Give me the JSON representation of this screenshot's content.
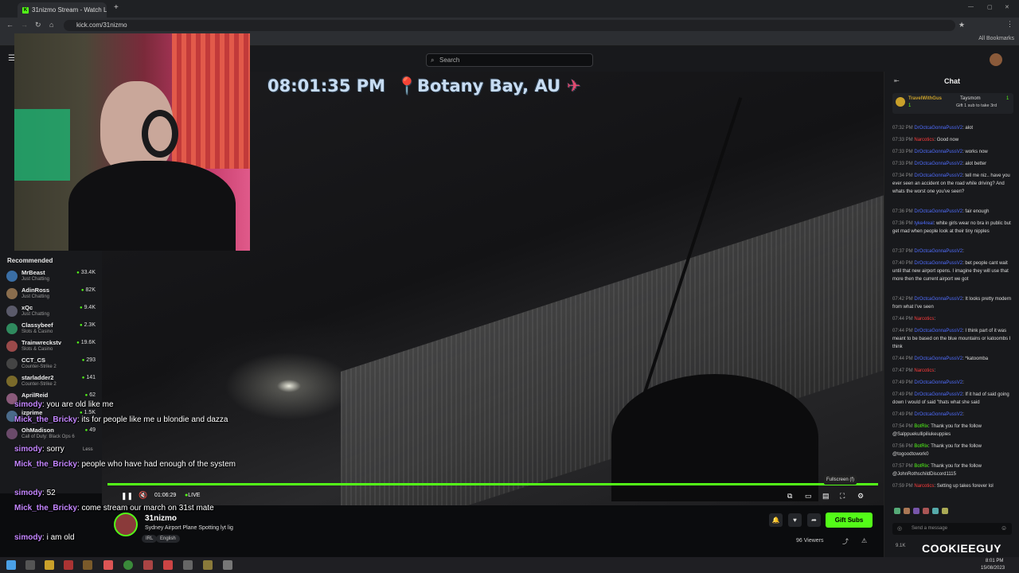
{
  "browser": {
    "tab_title": "31nizmo Stream - Watch Live o",
    "url": "kick.com/31nizmo",
    "bookmarks_label": "All Bookmarks"
  },
  "header": {
    "search_placeholder": "Search"
  },
  "sidebar": {
    "recommended_label": "Recommended",
    "items": [
      {
        "name": "MrBeast",
        "category": "Just Chatting",
        "viewers": "33.4K",
        "color": "#3a6ea5"
      },
      {
        "name": "AdinRoss",
        "category": "Just Chatting",
        "viewers": "82K",
        "color": "#8a6d4d"
      },
      {
        "name": "xQc",
        "category": "Just Chatting",
        "viewers": "9.4K",
        "color": "#5a5a6a"
      },
      {
        "name": "Classybeef",
        "category": "Slots & Casino",
        "viewers": "2.3K",
        "color": "#2f8a5e"
      },
      {
        "name": "Trainwreckstv",
        "category": "Slots & Casino",
        "viewers": "19.6K",
        "color": "#9a4a4a"
      },
      {
        "name": "CCT_CS",
        "category": "Counter-Strike 2",
        "viewers": "293",
        "color": "#444"
      },
      {
        "name": "starladder2",
        "category": "Counter-Strike 2",
        "viewers": "141",
        "color": "#7a6a2a"
      },
      {
        "name": "AprilReid",
        "category": "",
        "viewers": "62",
        "color": "#8a5a7a"
      },
      {
        "name": "izprime",
        "category": "",
        "viewers": "1.5K",
        "color": "#4a6a8a"
      },
      {
        "name": "OhMadison",
        "category": "Call of Duty: Black Ops 6",
        "viewers": "49",
        "color": "#6a4a6a"
      }
    ],
    "show_less": "Less"
  },
  "video": {
    "overlay_time": "08:01:35 PM",
    "overlay_location": "Botany Bay, AU",
    "elapsed": "01:06:29",
    "live_label": "LIVE",
    "fullscreen_tooltip": "Fullscreen (f)"
  },
  "overlay_chat": [
    {
      "user": "simody",
      "text": ": you are old like me"
    },
    {
      "user": "Mick_the_Bricky",
      "text": ": its for people like me u blondie and dazza"
    },
    {
      "user": "simody",
      "text": ": sorry"
    },
    {
      "user": "Mick_the_Bricky",
      "text": ": people who have had enough of the system"
    },
    {
      "user": "simody",
      "text": ": 52"
    },
    {
      "user": "Mick_the_Bricky",
      "text": ": come stream our march on 31st mate"
    },
    {
      "user": "simody",
      "text": ": i am old"
    }
  ],
  "channel": {
    "name": "31nizmo",
    "stream_title": "Sydney Airport Plane Spotting lyt lig",
    "tags": [
      "IRL",
      "English"
    ],
    "gift_label": "Gift Subs",
    "viewers": "96 Viewers"
  },
  "chat": {
    "title": "Chat",
    "pinned": [
      {
        "user": "TravelWithGus",
        "count": "1"
      },
      {
        "user": "Taysmom",
        "text": "Gift 1 sub to take 3rd",
        "count": "1"
      }
    ],
    "messages": [
      {
        "time": "07:32 PM",
        "user": "DrOctcaGonnaPussV2",
        "cls": "blue",
        "text": ": alot"
      },
      {
        "time": "07:33 PM",
        "user": "Narcotics",
        "cls": "red",
        "text": ": Good now"
      },
      {
        "time": "07:33 PM",
        "user": "DrOctcaGonnaPussV2",
        "cls": "blue",
        "text": ": works now"
      },
      {
        "time": "07:33 PM",
        "user": "DrOctcaGonnaPussV2",
        "cls": "blue",
        "text": ": alot better"
      },
      {
        "time": "07:34 PM",
        "user": "DrOctcaGonnaPussV2",
        "cls": "blue",
        "text": ": tell me niz.. have you ever seen an accident on the road while driving? And whats the worst one you've seen?"
      },
      {
        "time": "07:36 PM",
        "user": "DrOctcaGonnaPussV2",
        "cls": "blue",
        "text": ": fair enough"
      },
      {
        "time": "07:36 PM",
        "user": "tyke4real",
        "cls": "blue",
        "text": ": white girls wear no bra in public but get mad when people look at their tiny nipples"
      },
      {
        "time": "07:37 PM",
        "user": "DrOctcaGonnaPussV2",
        "cls": "blue",
        "text": ":"
      },
      {
        "time": "07:40 PM",
        "user": "DrOctcaGonnaPussV2",
        "cls": "blue",
        "text": ": bet people cant wait until that new airport opens. I imagine they will use that more then the current airport we got"
      },
      {
        "time": "07:42 PM",
        "user": "DrOctcaGonnaPussV2",
        "cls": "blue",
        "text": ": It looks pretty modern from what I've seen"
      },
      {
        "time": "07:44 PM",
        "user": "Narcotics",
        "cls": "red",
        "text": ":"
      },
      {
        "time": "07:44 PM",
        "user": "DrOctcaGonnaPussV2",
        "cls": "blue",
        "text": ": I think part of it was meant to be based on the blue mountains or katoombs I think"
      },
      {
        "time": "07:44 PM",
        "user": "DrOctcaGonnaPussV2",
        "cls": "blue",
        "text": ": *katoomba"
      },
      {
        "time": "07:47 PM",
        "user": "Narcotics",
        "cls": "red",
        "text": ":"
      },
      {
        "time": "07:49 PM",
        "user": "DrOctcaGonnaPussV2",
        "cls": "blue",
        "text": ":"
      },
      {
        "time": "07:49 PM",
        "user": "DrOctcaGonnaPussV2",
        "cls": "blue",
        "text": ": If it had of said going down I would of said \"thats what she said"
      },
      {
        "time": "07:49 PM",
        "user": "DrOctcaGonnaPussV2",
        "cls": "blue",
        "text": ":"
      },
      {
        "time": "07:54 PM",
        "user": "BotRix",
        "cls": "grn",
        "text": ": Thank you for the follow @Salppuekullipiliukeuppies"
      },
      {
        "time": "07:56 PM",
        "user": "BotRix",
        "cls": "grn",
        "text": ": Thank you for the follow @togoodtowork0"
      },
      {
        "time": "07:57 PM",
        "user": "BotRix",
        "cls": "grn",
        "text": ": Thank you for the follow @JohnRothschildDiscord1115"
      },
      {
        "time": "07:59 PM",
        "user": "Narcotics",
        "cls": "red",
        "text": ": Setting up takes forever lol"
      }
    ],
    "input_placeholder": "Send a message",
    "watermark": "COOKIEEGUY",
    "count_label": "9.1K"
  },
  "taskbar": {
    "time": "8:01 PM",
    "date": "15/08/2023"
  }
}
